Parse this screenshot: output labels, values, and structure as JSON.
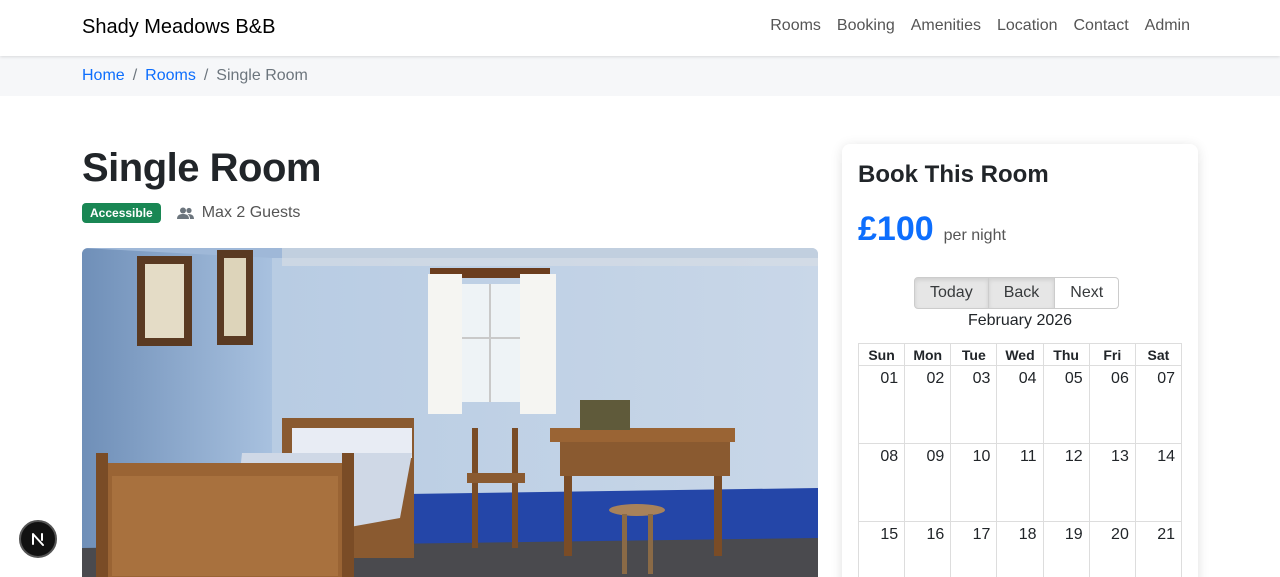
{
  "navbar": {
    "brand": "Shady Meadows B&B",
    "links": [
      "Rooms",
      "Booking",
      "Amenities",
      "Location",
      "Contact",
      "Admin"
    ]
  },
  "breadcrumb": {
    "home": "Home",
    "rooms": "Rooms",
    "current": "Single Room",
    "separator": "/"
  },
  "room": {
    "title": "Single Room",
    "badge": "Accessible",
    "guests": "Max 2 Guests",
    "image_icon": "room-photo"
  },
  "booking": {
    "title": "Book This Room",
    "price": "£100",
    "per_night": "per night",
    "toolbar": {
      "today": "Today",
      "back": "Back",
      "next": "Next"
    },
    "month": "February 2026",
    "weekdays": [
      "Sun",
      "Mon",
      "Tue",
      "Wed",
      "Thu",
      "Fri",
      "Sat"
    ],
    "weeks": [
      [
        "01",
        "02",
        "03",
        "04",
        "05",
        "06",
        "07"
      ],
      [
        "08",
        "09",
        "10",
        "11",
        "12",
        "13",
        "14"
      ],
      [
        "15",
        "16",
        "17",
        "18",
        "19",
        "20",
        "21"
      ]
    ]
  },
  "floating_button": {
    "icon": "next-logo-icon"
  },
  "colors": {
    "accent": "#0d6efd",
    "badge": "#198754",
    "breadcrumb_bg": "#f6f7f9"
  }
}
